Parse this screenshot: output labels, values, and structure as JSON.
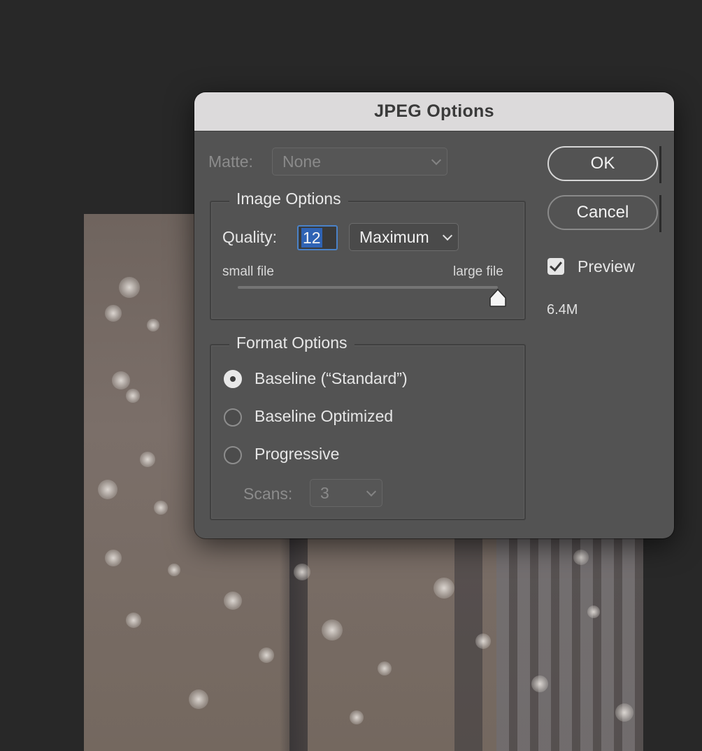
{
  "dialog": {
    "title": "JPEG Options",
    "matte": {
      "label": "Matte:",
      "value": "None"
    },
    "image_options": {
      "title": "Image Options",
      "quality_label": "Quality:",
      "quality_value": "12",
      "quality_preset": "Maximum",
      "slider_min_label": "small file",
      "slider_max_label": "large file",
      "slider_fraction": 1.0
    },
    "format_options": {
      "title": "Format Options",
      "options": [
        {
          "label": "Baseline (“Standard”)",
          "selected": true
        },
        {
          "label": "Baseline Optimized",
          "selected": false
        },
        {
          "label": "Progressive",
          "selected": false
        }
      ],
      "scans_label": "Scans:",
      "scans_value": "3"
    },
    "buttons": {
      "ok": "OK",
      "cancel": "Cancel"
    },
    "preview": {
      "label": "Preview",
      "checked": true
    },
    "file_size": "6.4M"
  }
}
